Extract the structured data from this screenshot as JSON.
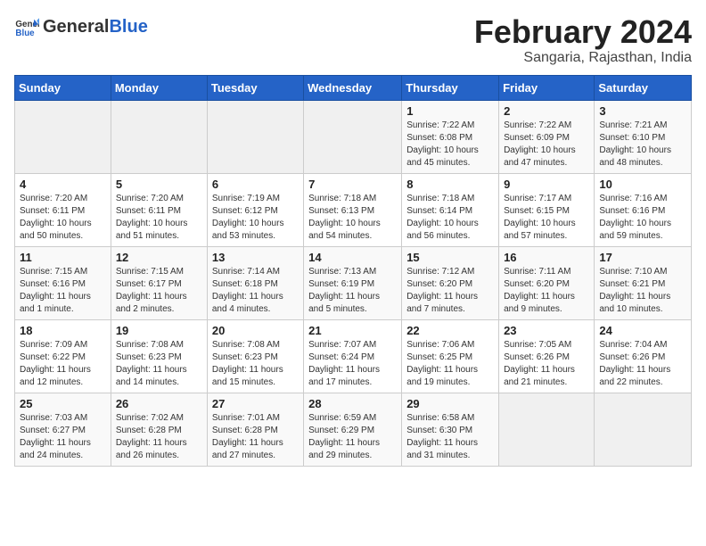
{
  "logo": {
    "general": "General",
    "blue": "Blue"
  },
  "title": {
    "month": "February 2024",
    "location": "Sangaria, Rajasthan, India"
  },
  "weekdays": [
    "Sunday",
    "Monday",
    "Tuesday",
    "Wednesday",
    "Thursday",
    "Friday",
    "Saturday"
  ],
  "weeks": [
    [
      {
        "day": "",
        "info": ""
      },
      {
        "day": "",
        "info": ""
      },
      {
        "day": "",
        "info": ""
      },
      {
        "day": "",
        "info": ""
      },
      {
        "day": "1",
        "info": "Sunrise: 7:22 AM\nSunset: 6:08 PM\nDaylight: 10 hours\nand 45 minutes."
      },
      {
        "day": "2",
        "info": "Sunrise: 7:22 AM\nSunset: 6:09 PM\nDaylight: 10 hours\nand 47 minutes."
      },
      {
        "day": "3",
        "info": "Sunrise: 7:21 AM\nSunset: 6:10 PM\nDaylight: 10 hours\nand 48 minutes."
      }
    ],
    [
      {
        "day": "4",
        "info": "Sunrise: 7:20 AM\nSunset: 6:11 PM\nDaylight: 10 hours\nand 50 minutes."
      },
      {
        "day": "5",
        "info": "Sunrise: 7:20 AM\nSunset: 6:11 PM\nDaylight: 10 hours\nand 51 minutes."
      },
      {
        "day": "6",
        "info": "Sunrise: 7:19 AM\nSunset: 6:12 PM\nDaylight: 10 hours\nand 53 minutes."
      },
      {
        "day": "7",
        "info": "Sunrise: 7:18 AM\nSunset: 6:13 PM\nDaylight: 10 hours\nand 54 minutes."
      },
      {
        "day": "8",
        "info": "Sunrise: 7:18 AM\nSunset: 6:14 PM\nDaylight: 10 hours\nand 56 minutes."
      },
      {
        "day": "9",
        "info": "Sunrise: 7:17 AM\nSunset: 6:15 PM\nDaylight: 10 hours\nand 57 minutes."
      },
      {
        "day": "10",
        "info": "Sunrise: 7:16 AM\nSunset: 6:16 PM\nDaylight: 10 hours\nand 59 minutes."
      }
    ],
    [
      {
        "day": "11",
        "info": "Sunrise: 7:15 AM\nSunset: 6:16 PM\nDaylight: 11 hours\nand 1 minute."
      },
      {
        "day": "12",
        "info": "Sunrise: 7:15 AM\nSunset: 6:17 PM\nDaylight: 11 hours\nand 2 minutes."
      },
      {
        "day": "13",
        "info": "Sunrise: 7:14 AM\nSunset: 6:18 PM\nDaylight: 11 hours\nand 4 minutes."
      },
      {
        "day": "14",
        "info": "Sunrise: 7:13 AM\nSunset: 6:19 PM\nDaylight: 11 hours\nand 5 minutes."
      },
      {
        "day": "15",
        "info": "Sunrise: 7:12 AM\nSunset: 6:20 PM\nDaylight: 11 hours\nand 7 minutes."
      },
      {
        "day": "16",
        "info": "Sunrise: 7:11 AM\nSunset: 6:20 PM\nDaylight: 11 hours\nand 9 minutes."
      },
      {
        "day": "17",
        "info": "Sunrise: 7:10 AM\nSunset: 6:21 PM\nDaylight: 11 hours\nand 10 minutes."
      }
    ],
    [
      {
        "day": "18",
        "info": "Sunrise: 7:09 AM\nSunset: 6:22 PM\nDaylight: 11 hours\nand 12 minutes."
      },
      {
        "day": "19",
        "info": "Sunrise: 7:08 AM\nSunset: 6:23 PM\nDaylight: 11 hours\nand 14 minutes."
      },
      {
        "day": "20",
        "info": "Sunrise: 7:08 AM\nSunset: 6:23 PM\nDaylight: 11 hours\nand 15 minutes."
      },
      {
        "day": "21",
        "info": "Sunrise: 7:07 AM\nSunset: 6:24 PM\nDaylight: 11 hours\nand 17 minutes."
      },
      {
        "day": "22",
        "info": "Sunrise: 7:06 AM\nSunset: 6:25 PM\nDaylight: 11 hours\nand 19 minutes."
      },
      {
        "day": "23",
        "info": "Sunrise: 7:05 AM\nSunset: 6:26 PM\nDaylight: 11 hours\nand 21 minutes."
      },
      {
        "day": "24",
        "info": "Sunrise: 7:04 AM\nSunset: 6:26 PM\nDaylight: 11 hours\nand 22 minutes."
      }
    ],
    [
      {
        "day": "25",
        "info": "Sunrise: 7:03 AM\nSunset: 6:27 PM\nDaylight: 11 hours\nand 24 minutes."
      },
      {
        "day": "26",
        "info": "Sunrise: 7:02 AM\nSunset: 6:28 PM\nDaylight: 11 hours\nand 26 minutes."
      },
      {
        "day": "27",
        "info": "Sunrise: 7:01 AM\nSunset: 6:28 PM\nDaylight: 11 hours\nand 27 minutes."
      },
      {
        "day": "28",
        "info": "Sunrise: 6:59 AM\nSunset: 6:29 PM\nDaylight: 11 hours\nand 29 minutes."
      },
      {
        "day": "29",
        "info": "Sunrise: 6:58 AM\nSunset: 6:30 PM\nDaylight: 11 hours\nand 31 minutes."
      },
      {
        "day": "",
        "info": ""
      },
      {
        "day": "",
        "info": ""
      }
    ]
  ]
}
